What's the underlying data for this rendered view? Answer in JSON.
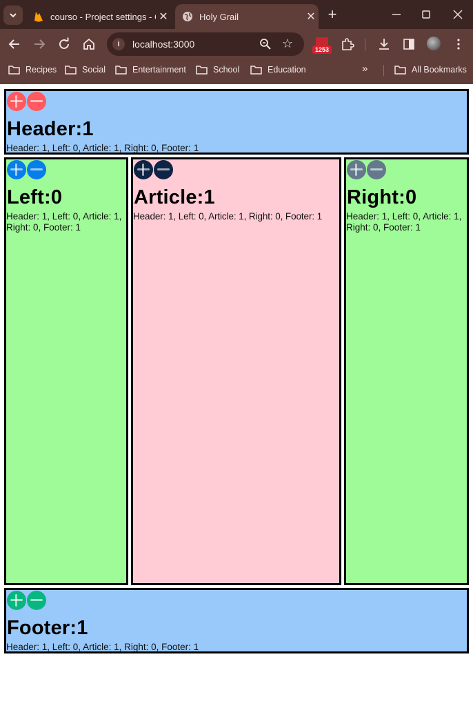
{
  "browser": {
    "tabs": [
      {
        "title": "courso - Project settings - C",
        "active": false
      },
      {
        "title": "Holy Grail",
        "active": true
      }
    ],
    "address": "localhost:3000",
    "extension_badge": "1253",
    "bookmarks": [
      "Recipes",
      "Social",
      "Entertainment",
      "School",
      "Education"
    ],
    "all_bookmarks": "All Bookmarks"
  },
  "colors": {
    "header_bg": "#99c9fa",
    "side_bg": "#9ffa98",
    "article_bg": "#ffccd6",
    "header_btn": "#ff5a5f",
    "left_btn": "#087ee9",
    "article_btn": "#0d2445",
    "right_btn": "#64798c",
    "footer_btn": "#06b87f"
  },
  "panels": {
    "header": {
      "title": "Header:1",
      "stats": "Header: 1, Left: 0, Article: 1, Right: 0, Footer: 1"
    },
    "left": {
      "title": "Left:0",
      "stats": "Header: 1, Left: 0, Article: 1, Right: 0, Footer: 1"
    },
    "article": {
      "title": "Article:1",
      "stats": "Header: 1, Left: 0, Article: 1, Right: 0, Footer: 1"
    },
    "right": {
      "title": "Right:0",
      "stats": "Header: 1, Left: 0, Article: 1, Right: 0, Footer: 1"
    },
    "footer": {
      "title": "Footer:1",
      "stats": "Header: 1, Left: 0, Article: 1, Right: 0, Footer: 1"
    }
  }
}
